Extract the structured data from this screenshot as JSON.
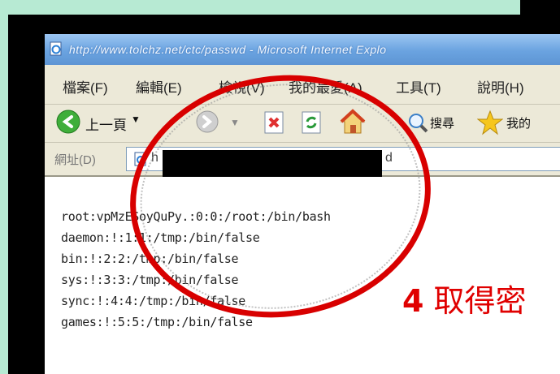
{
  "window": {
    "title": "http://www.tolchz.net/ctc/passwd - Microsoft Internet Explo"
  },
  "menu": [
    "檔案(F)",
    "編輯(E)",
    "檢視(V)",
    "我的最愛(A)",
    "工具(T)",
    "說明(H)"
  ],
  "toolbar": {
    "back_label": "上一頁",
    "search_label": "搜尋",
    "favorites_label": "我的"
  },
  "address": {
    "label": "網址(D)",
    "value_prefix": "h",
    "value_suffix": "d"
  },
  "file_lines": [
    "root:vpMzESoyQuPy.:0:0:/root:/bin/bash",
    "daemon:!:1:1:/tmp:/bin/false",
    "bin:!:2:2:/tmp:/bin/false",
    "sys:!:3:3:/tmp:/bin/false",
    "sync:!:4:4:/tmp:/bin/false",
    "games:!:5:5:/tmp:/bin/false"
  ],
  "caption": {
    "number": "4",
    "text": "取得密"
  },
  "colors": {
    "accent_red": "#e00000",
    "background_mint": "#b7ead3",
    "titlebar_blue": "#6aa3e0"
  }
}
